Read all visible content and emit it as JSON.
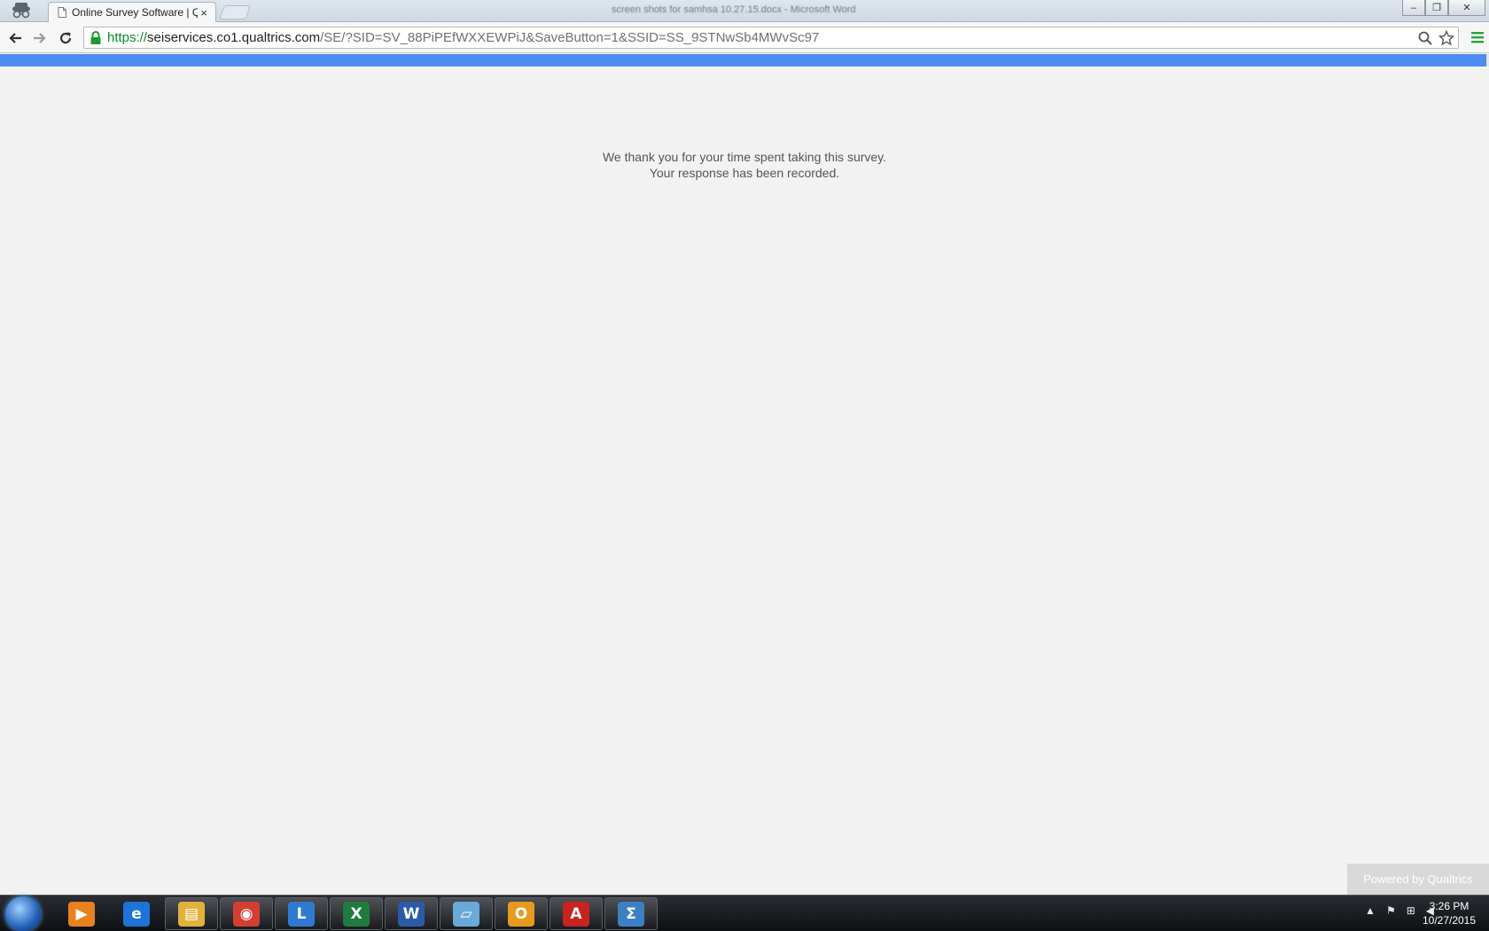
{
  "browser": {
    "tab_title": "Online Survey Software | Q",
    "tab_close": "×",
    "background_window_title": "screen shots for samhsa 10.27.15.docx - Microsoft Word",
    "url": {
      "scheme": "https://",
      "host": "seiservices.co1.qualtrics.com",
      "path": "/SE/?SID=SV_88PiPEfWXXEWPiJ&SaveButton=1&SSID=SS_9STNwSb4MWvSc97"
    },
    "window_controls": {
      "minimize": "‒",
      "restore": "❐",
      "close": "✕"
    },
    "loading_progress": 0.998,
    "accent_color": "#4e8cf0"
  },
  "page": {
    "message_line1": "We thank you for your time spent taking this survey.",
    "message_line2": "Your response has been recorded.",
    "powered_by": "Powered by Qualtrics"
  },
  "taskbar": {
    "apps": [
      {
        "name": "windows-media-player",
        "glyph": "▶",
        "color": "#e8821e",
        "open": false
      },
      {
        "name": "internet-explorer",
        "glyph": "e",
        "color": "#1e73d6",
        "open": false
      },
      {
        "name": "windows-explorer",
        "glyph": "▤",
        "color": "#e2b23c",
        "open": true
      },
      {
        "name": "google-chrome",
        "glyph": "◉",
        "color": "#d23f31",
        "open": true
      },
      {
        "name": "lync",
        "glyph": "L",
        "color": "#2f7ad1",
        "open": true
      },
      {
        "name": "excel",
        "glyph": "X",
        "color": "#1f7b3e",
        "open": true
      },
      {
        "name": "word",
        "glyph": "W",
        "color": "#2b5aa8",
        "open": true
      },
      {
        "name": "notebook",
        "glyph": "▱",
        "color": "#6aa9d8",
        "open": true
      },
      {
        "name": "outlook",
        "glyph": "O",
        "color": "#e79a1d",
        "open": true
      },
      {
        "name": "adobe-reader",
        "glyph": "A",
        "color": "#c8231e",
        "open": true
      },
      {
        "name": "math-input",
        "glyph": "Σ",
        "color": "#3d7fc4",
        "open": true
      }
    ],
    "tray": {
      "show_hidden": "▲",
      "flag": "⚑",
      "network": "⊞",
      "volume": "◀"
    },
    "clock_time": "3:26 PM",
    "clock_date": "10/27/2015"
  }
}
